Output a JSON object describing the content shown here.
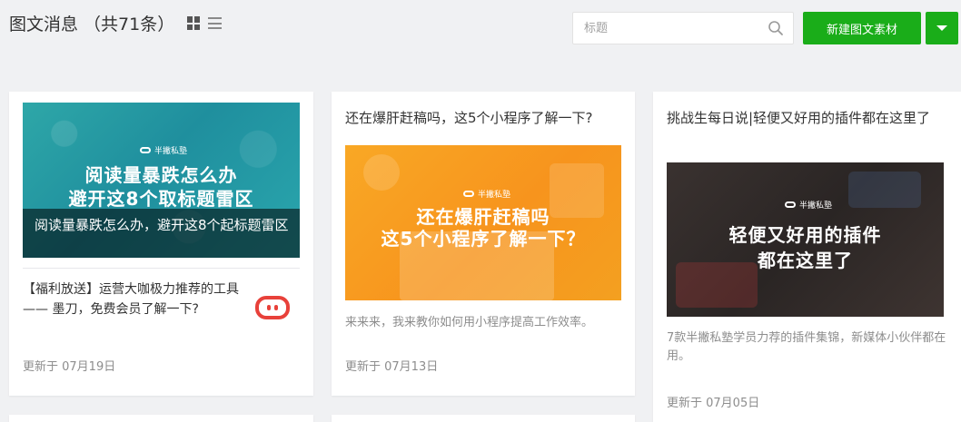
{
  "header": {
    "title": "图文消息 （共71条）",
    "search_placeholder": "标题",
    "new_button_label": "新建图文素材",
    "icons": {
      "grid_view": "grid-icon",
      "list_view": "list-icon",
      "search": "search-icon",
      "dropdown": "caret-down-icon"
    }
  },
  "colors": {
    "accent": "#1aad19",
    "muted_text": "#8d8d8d",
    "page_bg": "#f0f1f3"
  },
  "cards": [
    {
      "cover_brand": "半撇私塾",
      "cover_line_1": "阅读量暴跌怎么办",
      "cover_line_2": "避开这8个取标题雷区",
      "title": "阅读量暴跌怎么办，避开这8个起标题雷区",
      "sub_article_title": "【福利放送】运营大咖极力推荐的工具 —— 墨刀，免费会员了解一下?",
      "updated": "更新于 07月19日"
    },
    {
      "title": "还在爆肝赶稿吗，这5个小程序了解一下?",
      "cover_brand": "半撇私塾",
      "cover_line_1": "还在爆肝赶稿吗",
      "cover_line_2": "这5个小程序了解一下？",
      "description": "来来来，我来教你如何用小程序提高工作效率。",
      "updated": "更新于 07月13日"
    },
    {
      "title": "挑战生每日说|轻便又好用的插件都在这里了",
      "cover_brand": "半撇私塾",
      "cover_line_1": "轻便又好用的插件",
      "cover_line_2": "都在这里了",
      "description": "7款半撇私塾学员力荐的插件集锦，新媒体小伙伴都在用。",
      "updated": "更新于 07月05日"
    }
  ]
}
